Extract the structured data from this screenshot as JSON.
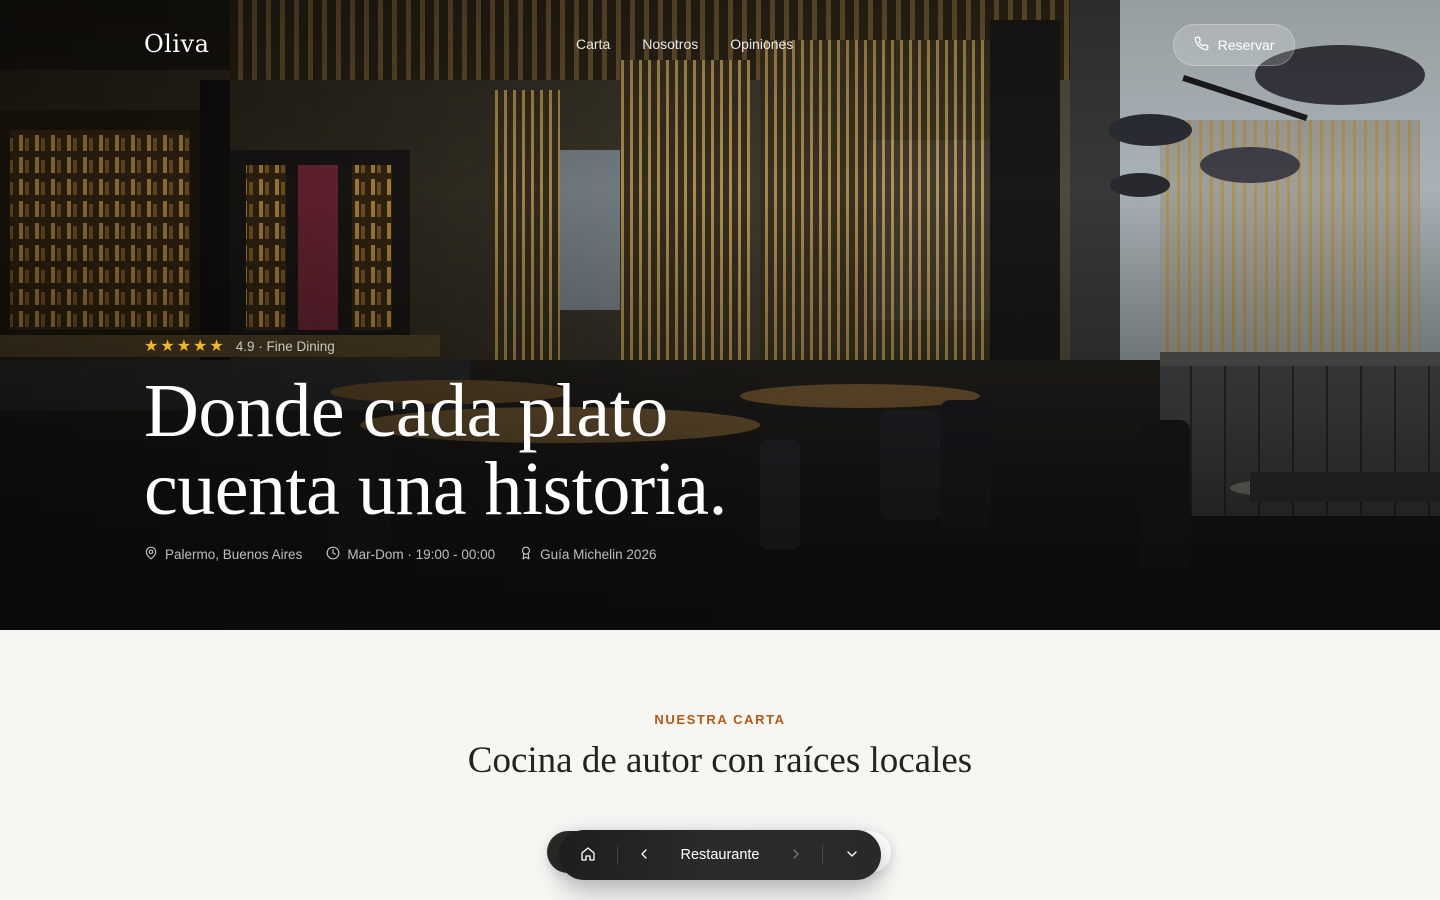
{
  "brand": {
    "name": "Oliva"
  },
  "nav": {
    "links": [
      "Carta",
      "Nosotros",
      "Opiniones"
    ],
    "cta_label": "Reservar"
  },
  "hero": {
    "rating": 4.9,
    "rating_text": "4.9 · Fine Dining",
    "stars": 5,
    "headline_line1": "Donde cada plato",
    "headline_line2": "cuenta una historia.",
    "meta": {
      "location": "Palermo, Buenos Aires",
      "hours": "Mar-Dom · 19:00 - 00:00",
      "award": "Guía Michelin 2026"
    }
  },
  "menu_section": {
    "eyebrow": "NUESTRA CARTA",
    "title": "Cocina de autor con raíces locales"
  },
  "toolbar": {
    "label": "Restaurante",
    "icons": [
      "home-icon",
      "chevron-left-icon",
      "chevron-right-icon",
      "chevron-down-icon"
    ]
  },
  "colors": {
    "accent": "#b15a17",
    "star": "#f5b52e",
    "page_bg": "#f7f6f3",
    "title_text": "#242320",
    "toolbar_bg": "#2a2927"
  }
}
